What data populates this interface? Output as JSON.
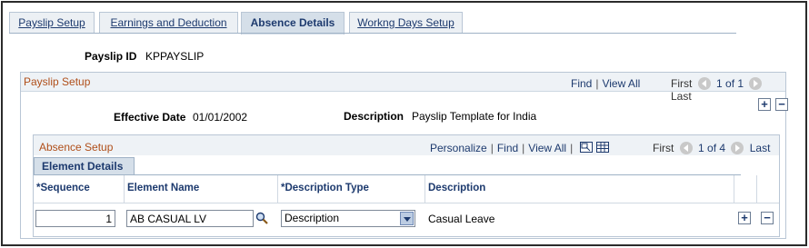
{
  "tabs": [
    {
      "label": "Payslip Setup",
      "active": false
    },
    {
      "label": "Earnings and Deduction",
      "active": false
    },
    {
      "label": "Absence Details",
      "active": true
    },
    {
      "label": "Workng Days Setup",
      "active": false
    }
  ],
  "header": {
    "payslip_id_label": "Payslip ID",
    "payslip_id_value": "KPPAYSLIP"
  },
  "payslip_setup": {
    "title": "Payslip Setup",
    "find": "Find",
    "view_all": "View All",
    "first": "First",
    "pager": "1 of 1",
    "last": "Last",
    "effective_date_label": "Effective Date",
    "effective_date_value": "01/01/2002",
    "description_label": "Description",
    "description_value": "Payslip Template for India",
    "add": "+",
    "remove": "−"
  },
  "absence_setup": {
    "title": "Absence Setup",
    "personalize": "Personalize",
    "find": "Find",
    "view_all": "View All",
    "first": "First",
    "pager": "1 of 4",
    "last": "Last",
    "subtab": "Element Details",
    "columns": {
      "sequence": "*Sequence",
      "element_name": "Element Name",
      "description_type": "*Description Type",
      "description": "Description"
    },
    "row": {
      "sequence": "1",
      "element_name": "AB CASUAL LV",
      "description_type": "Description",
      "description": "Casual Leave"
    },
    "add": "+",
    "remove": "−"
  },
  "icons": [
    "left-arrow-icon",
    "right-arrow-icon",
    "zoom-icon",
    "grid-icon",
    "search-icon",
    "dropdown-icon"
  ],
  "colors": {
    "section_title": "#b04f1a",
    "link": "#1d3a6e",
    "active_tab": "#d5dfe9"
  }
}
